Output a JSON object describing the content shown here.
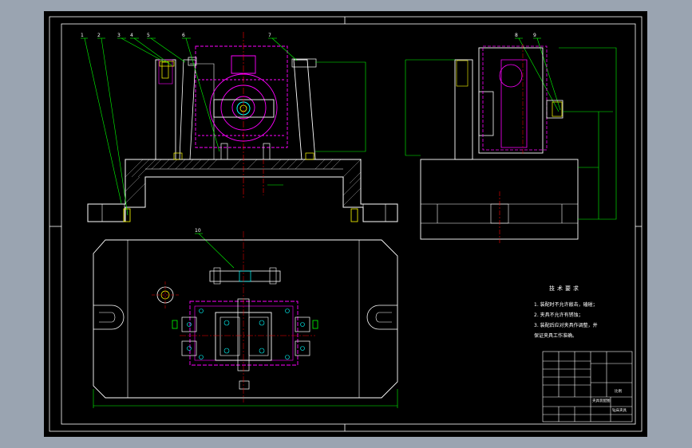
{
  "drawing": {
    "colors": {
      "background": "#9aa4b1",
      "sheet": "#000000",
      "outline": "#ffffff",
      "leader": "#00ff00",
      "part": "#ff00ff",
      "centerline": "#ff0000",
      "hatch": "#ffff00",
      "bolt": "#00ffff"
    },
    "callouts": [
      "1",
      "2",
      "3",
      "4",
      "5",
      "6",
      "7",
      "8",
      "9",
      "10"
    ],
    "technical_requirements": {
      "title": "技术要求",
      "items": [
        "1. 装配时不允许敲击，磕碰；",
        "2. 夹具不允许有锈蚀；",
        "3. 装配后应对夹具作调整，并",
        "保证夹具工作准确。"
      ]
    },
    "title_block": {
      "name": "夹具装配图",
      "drawing_no": "钻床夹具",
      "scale": "比例"
    }
  }
}
